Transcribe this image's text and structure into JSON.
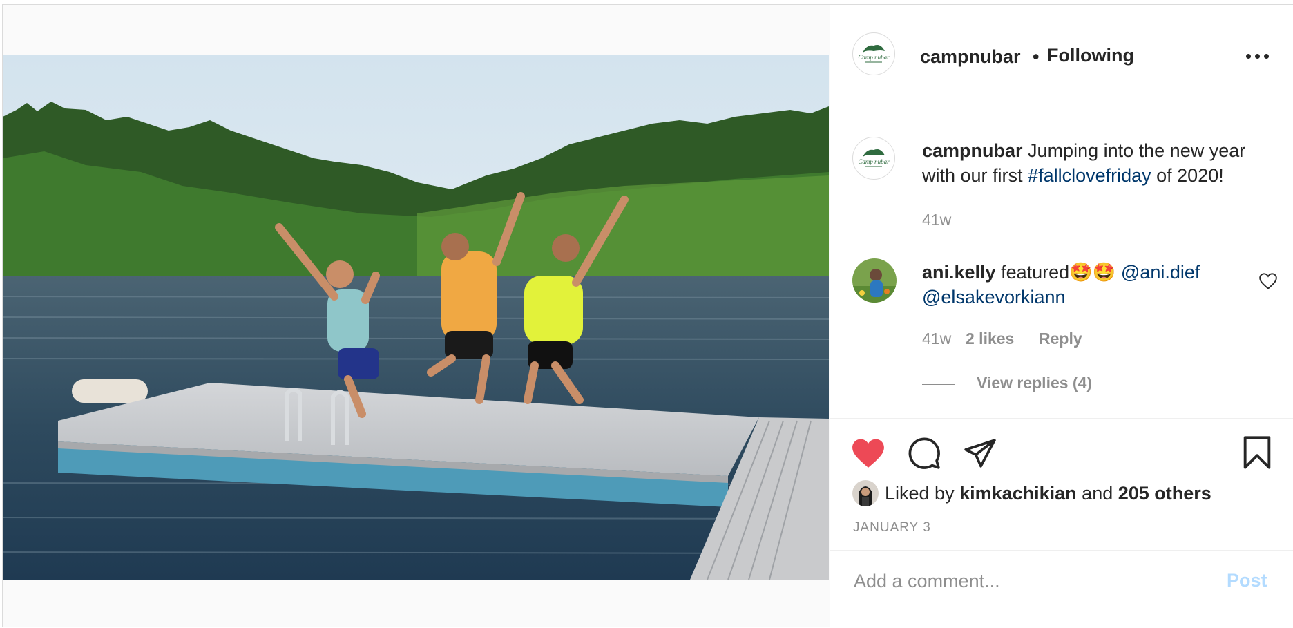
{
  "post": {
    "username": "campnubar",
    "separator": "•",
    "follow_status": "Following",
    "caption_username": "campnubar",
    "caption_text": " Jumping into the new year with our first ",
    "caption_hashtag": "#fallclovefriday",
    "caption_tail": " of 2020!",
    "caption_age": "41w",
    "logo_text": "Camp nubar"
  },
  "comment": {
    "username": "ani.kelly",
    "text": " featured🤩🤩 ",
    "mention1": "@ani.dief",
    "mention2": "@elsakevorkiann",
    "age": "41w",
    "likes": "2 likes",
    "reply_label": "Reply",
    "view_replies": "View replies (4)"
  },
  "likes": {
    "prefix": "Liked by ",
    "user": "kimkachikian",
    "middle": " and ",
    "others": "205 others"
  },
  "date": "JANUARY 3",
  "add_comment": {
    "placeholder": "Add a comment...",
    "post_label": "Post"
  },
  "icons": {
    "like": "heart-filled-icon",
    "comment": "speech-bubble-icon",
    "share": "paper-plane-icon",
    "save": "bookmark-icon",
    "more": "more-horizontal-icon",
    "comment_like": "heart-outline-icon"
  },
  "colors": {
    "like_red": "#ed4956",
    "link_blue": "#00376b",
    "muted": "#8e8e8e",
    "post_disabled": "#b3dbff"
  }
}
